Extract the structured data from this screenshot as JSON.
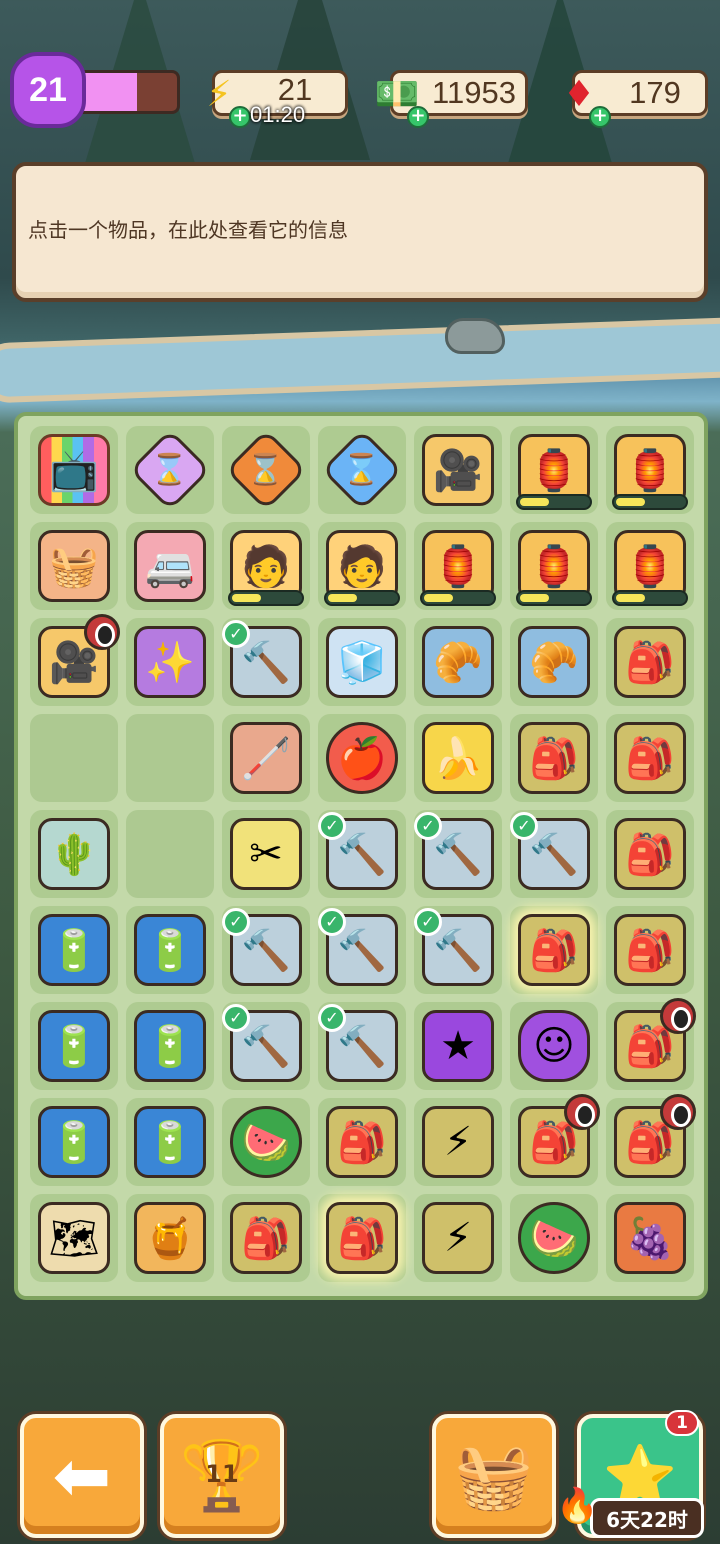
{
  "hud": {
    "level": "21",
    "level_progress": 0.62,
    "energy": "21",
    "energy_timer": "01:20",
    "cash": "11953",
    "gems": "179"
  },
  "info_panel": {
    "text": "点击一个物品，在此处查看它的信息"
  },
  "board": {
    "rows": [
      [
        {
          "name": "tv-item",
          "cls": "tv",
          "glyph": "📺"
        },
        {
          "name": "purple-hourglass-item",
          "cls": "hg-purple",
          "glyph": "⌛"
        },
        {
          "name": "orange-hourglass-item",
          "cls": "hg-orange",
          "glyph": "⌛"
        },
        {
          "name": "blue-hourglass-item",
          "cls": "hg-blue",
          "glyph": "⌛"
        },
        {
          "name": "camera-operator-item",
          "cls": "camera",
          "glyph": "🎥"
        },
        {
          "name": "lantern-cart-item",
          "cls": "cart",
          "glyph": "🏮",
          "progress": 0.4
        },
        {
          "name": "lantern-cart-item",
          "cls": "cart",
          "glyph": "🏮",
          "progress": 0.4
        }
      ],
      [
        {
          "name": "picnic-food-item",
          "cls": "picnic",
          "glyph": "🧺"
        },
        {
          "name": "camper-truck-item",
          "cls": "truck",
          "glyph": "🚐"
        },
        {
          "name": "worker-item",
          "cls": "person",
          "glyph": "🧑",
          "progress": 0.4
        },
        {
          "name": "worker-item",
          "cls": "person",
          "glyph": "🧑",
          "progress": 0.4
        },
        {
          "name": "lantern-cart-item",
          "cls": "cart",
          "glyph": "🏮",
          "progress": 0.4
        },
        {
          "name": "lantern-cart-item",
          "cls": "cart",
          "glyph": "🏮",
          "progress": 0.4
        },
        {
          "name": "lantern-cart-item",
          "cls": "cart",
          "glyph": "🏮",
          "progress": 0.4
        }
      ],
      [
        {
          "name": "camera-operator-item",
          "cls": "camera",
          "glyph": "🎥",
          "clock": true
        },
        {
          "name": "magic-box-item",
          "cls": "magic",
          "glyph": "✨"
        },
        {
          "name": "hammer-item",
          "cls": "hammer",
          "glyph": "🔨",
          "check": true
        },
        {
          "name": "cooler-box-item",
          "cls": "cooler",
          "glyph": "🧊"
        },
        {
          "name": "bread-chest-item",
          "cls": "chest",
          "glyph": "🥐"
        },
        {
          "name": "bread-chest-item",
          "cls": "chest",
          "glyph": "🥐"
        },
        {
          "name": "backpack-item",
          "cls": "backpack",
          "glyph": "🎒"
        }
      ],
      [
        {
          "name": "empty-cell"
        },
        {
          "name": "empty-cell"
        },
        {
          "name": "cane-item",
          "cls": "cane",
          "glyph": "🦯"
        },
        {
          "name": "apple-item",
          "cls": "apple",
          "glyph": "🍎"
        },
        {
          "name": "banana-item",
          "cls": "banana",
          "glyph": "🍌"
        },
        {
          "name": "backpack-item",
          "cls": "backpack",
          "glyph": "🎒"
        },
        {
          "name": "backpack-item",
          "cls": "backpack",
          "glyph": "🎒"
        }
      ],
      [
        {
          "name": "cactus-tools-item",
          "cls": "cactus",
          "glyph": "🌵"
        },
        {
          "name": "empty-cell"
        },
        {
          "name": "scissors-item",
          "cls": "scissors",
          "glyph": "✂"
        },
        {
          "name": "hammer-item",
          "cls": "hammer",
          "glyph": "🔨",
          "check": true
        },
        {
          "name": "hammer-item",
          "cls": "hammer",
          "glyph": "🔨",
          "check": true
        },
        {
          "name": "hammer-item",
          "cls": "hammer",
          "glyph": "🔨",
          "check": true
        },
        {
          "name": "backpack-item",
          "cls": "backpack",
          "glyph": "🎒"
        }
      ],
      [
        {
          "name": "battery-item",
          "cls": "battery",
          "glyph": "🔋"
        },
        {
          "name": "battery-item",
          "cls": "battery",
          "glyph": "🔋"
        },
        {
          "name": "hammer-item",
          "cls": "hammer",
          "glyph": "🔨",
          "check": true
        },
        {
          "name": "hammer-item",
          "cls": "hammer",
          "glyph": "🔨",
          "check": true
        },
        {
          "name": "hammer-item",
          "cls": "hammer",
          "glyph": "🔨",
          "check": true
        },
        {
          "name": "bubble-backpack-item",
          "cls": "backpack glow",
          "glyph": "🎒"
        },
        {
          "name": "backpack-item",
          "cls": "backpack",
          "glyph": "🎒"
        }
      ],
      [
        {
          "name": "battery-item",
          "cls": "battery",
          "glyph": "🔋"
        },
        {
          "name": "battery-item",
          "cls": "battery",
          "glyph": "🔋"
        },
        {
          "name": "hammer-item",
          "cls": "hammer",
          "glyph": "🔨",
          "check": true
        },
        {
          "name": "hammer-item",
          "cls": "hammer",
          "glyph": "🔨",
          "check": true
        },
        {
          "name": "purple-star-item",
          "cls": "star-purple",
          "glyph": "★"
        },
        {
          "name": "purple-blob-item",
          "cls": "blob",
          "glyph": "☺"
        },
        {
          "name": "backpack-item",
          "cls": "backpack",
          "glyph": "🎒",
          "clock": true
        }
      ],
      [
        {
          "name": "battery-item",
          "cls": "battery",
          "glyph": "🔋"
        },
        {
          "name": "battery-item",
          "cls": "battery",
          "glyph": "🔋"
        },
        {
          "name": "watermelon-item",
          "cls": "melon",
          "glyph": "🍉"
        },
        {
          "name": "backpack-item",
          "cls": "backpack",
          "glyph": "🎒"
        },
        {
          "name": "energy-backpack-item",
          "cls": "backpack",
          "glyph": "⚡"
        },
        {
          "name": "backpack-item",
          "cls": "backpack",
          "glyph": "🎒",
          "clock": true
        },
        {
          "name": "backpack-item",
          "cls": "backpack",
          "glyph": "🎒",
          "clock": true
        }
      ],
      [
        {
          "name": "map-item",
          "cls": "map",
          "glyph": "🗺"
        },
        {
          "name": "honey-jar-item",
          "cls": "jar",
          "glyph": "🍯"
        },
        {
          "name": "backpack-item",
          "cls": "backpack",
          "glyph": "🎒"
        },
        {
          "name": "bubble-backpack-item",
          "cls": "backpack glow",
          "glyph": "🎒"
        },
        {
          "name": "energy-backpack-item",
          "cls": "backpack",
          "glyph": "⚡"
        },
        {
          "name": "watermelon-item",
          "cls": "melon",
          "glyph": "🍉"
        },
        {
          "name": "fruit-basket-item",
          "cls": "fruits",
          "glyph": "🍇"
        }
      ]
    ]
  },
  "bottom": {
    "trophy_count": "11",
    "event_badge": "1",
    "event_time": "6天22时"
  },
  "icons": {
    "back": "back-arrow-icon",
    "trophy": "trophy-icon",
    "basket": "basket-icon",
    "event": "star-event-icon",
    "energy": "lightning-icon",
    "cash": "cash-icon",
    "gems": "gem-icon"
  },
  "colors": {
    "accent": "#f8a83a",
    "level": "#b654e8",
    "board": "#c3d9a9",
    "event": "#3ac48a"
  }
}
